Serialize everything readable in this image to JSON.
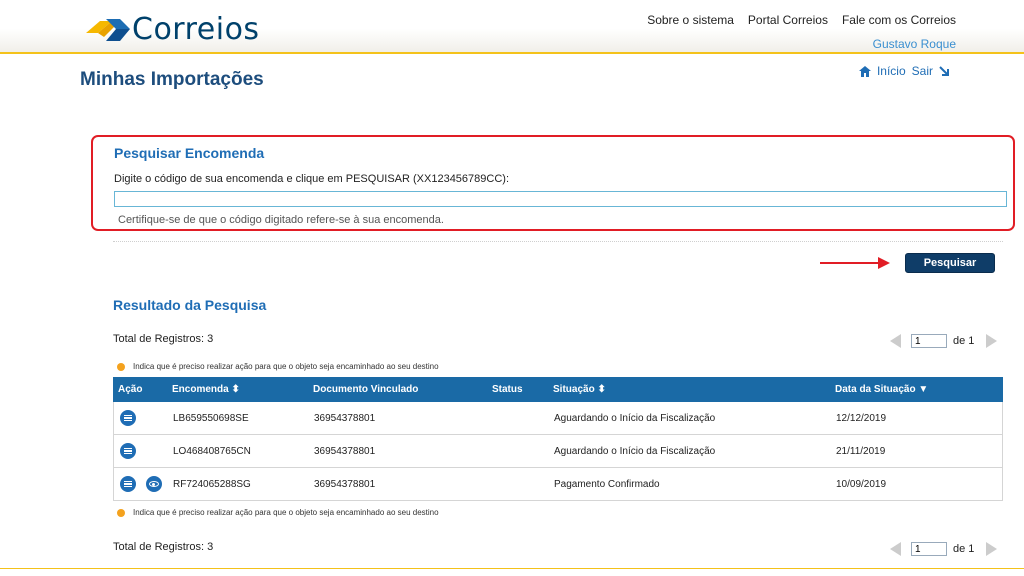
{
  "header": {
    "logo_text": "Correios",
    "nav": [
      "Sobre o sistema",
      "Portal Correios",
      "Fale com os Correios"
    ],
    "user": "Gustavo Roque"
  },
  "page": {
    "title": "Minhas Importações",
    "links": {
      "home": "Início",
      "logout": "Sair"
    }
  },
  "search": {
    "title": "Pesquisar Encomenda",
    "instruction": "Digite o código de sua encomenda e clique em PESQUISAR (XX123456789CC):",
    "input_value": "",
    "placeholder": "",
    "hint": "Certifique-se de que o código digitado refere-se à sua encomenda.",
    "button": "Pesquisar"
  },
  "results": {
    "title": "Resultado da Pesquisa",
    "total": "Total de Registros: 3",
    "note": "Indica que é preciso realizar ação para que o objeto seja encaminhado ao seu destino",
    "pager": {
      "page": "1",
      "of": "de 1"
    },
    "headers": {
      "acao": "Ação",
      "encomenda": "Encomenda ⬍",
      "documento": "Documento Vinculado",
      "status": "Status",
      "situacao": "Situação ⬍",
      "data": "Data da Situação ▼"
    },
    "rows": [
      {
        "encomenda": "LB659550698SE",
        "documento": "36954378801",
        "status": "",
        "situacao": "Aguardando o Início da Fiscalização",
        "data": "12/12/2019"
      },
      {
        "encomenda": "LO468408765CN",
        "documento": "36954378801",
        "status": "",
        "situacao": "Aguardando o Início da Fiscalização",
        "data": "21/11/2019"
      },
      {
        "encomenda": "RF724065288SG",
        "documento": "36954378801",
        "status": "",
        "situacao": "Pagamento Confirmado",
        "data": "10/09/2019"
      }
    ]
  },
  "colors": {
    "brand_blue": "#00416b",
    "accent_yellow": "#f4c21a",
    "link_blue": "#1f6db5",
    "table_header": "#1a6aa6",
    "highlight_red": "#e11d25",
    "warning_dot": "#f4a21e"
  }
}
